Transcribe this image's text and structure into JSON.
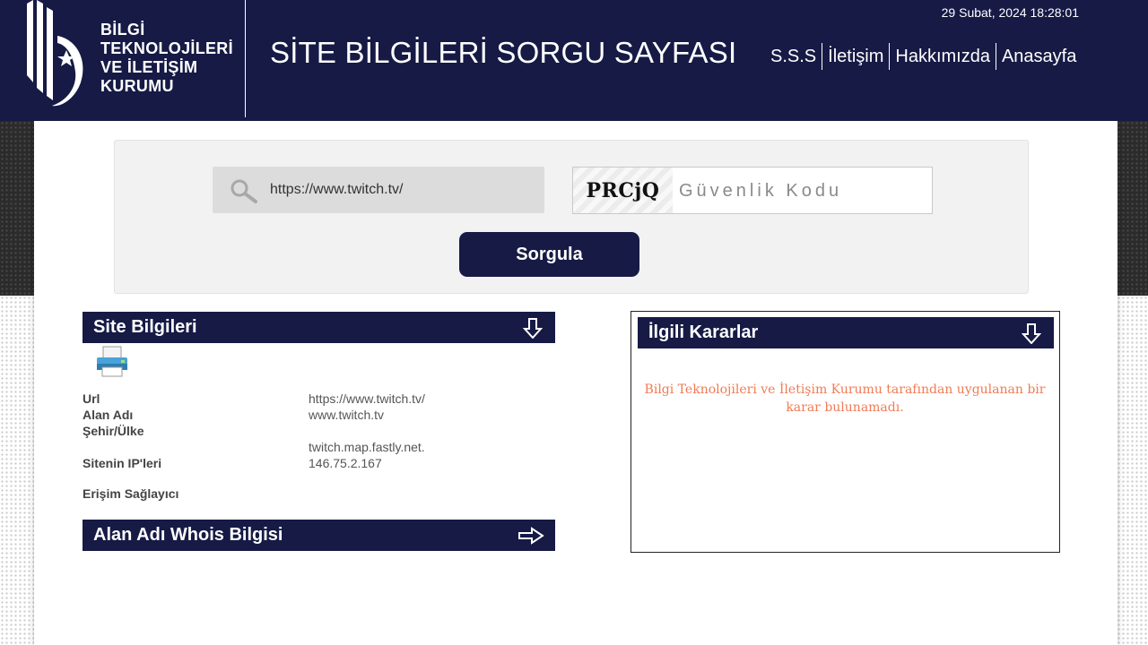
{
  "header": {
    "logo_lines": [
      "BİLGİ",
      "TEKNOLOJİLERİ",
      "VE İLETİŞİM",
      "KURUMU"
    ],
    "title": "SİTE BİLGİLERİ SORGU SAYFASI",
    "datetime": "29 Subat, 2024 18:28:01",
    "nav": [
      "S.S.S",
      "İletişim",
      "Hakkımızda",
      "Anasayfa"
    ],
    "background_color": "#161a45"
  },
  "search": {
    "url_value": "https://www.twitch.tv/",
    "captcha_text": "PRCjQ",
    "captcha_placeholder": "Güvenlik Kodu",
    "submit_label": "Sorgula"
  },
  "site_info": {
    "title": "Site Bilgileri",
    "rows": {
      "url": {
        "label": "Url",
        "value": "https://www.twitch.tv/"
      },
      "domain": {
        "label": "Alan Adı",
        "value": "www.twitch.tv"
      },
      "city_country": {
        "label": "Şehir/Ülke",
        "value": ""
      },
      "ips": {
        "label": "Sitenin IP'leri",
        "value_line1": "twitch.map.fastly.net.",
        "value_line2": "146.75.2.167"
      },
      "provider": {
        "label": "Erişim Sağlayıcı",
        "value": ""
      }
    }
  },
  "whois": {
    "title": "Alan Adı Whois Bilgisi"
  },
  "decisions": {
    "title": "İlgili Kararlar",
    "message": "Bilgi Teknolojileri ve İletişim Kurumu tarafından uygulanan bir karar bulunamadı.",
    "message_color": "#f07b55"
  }
}
